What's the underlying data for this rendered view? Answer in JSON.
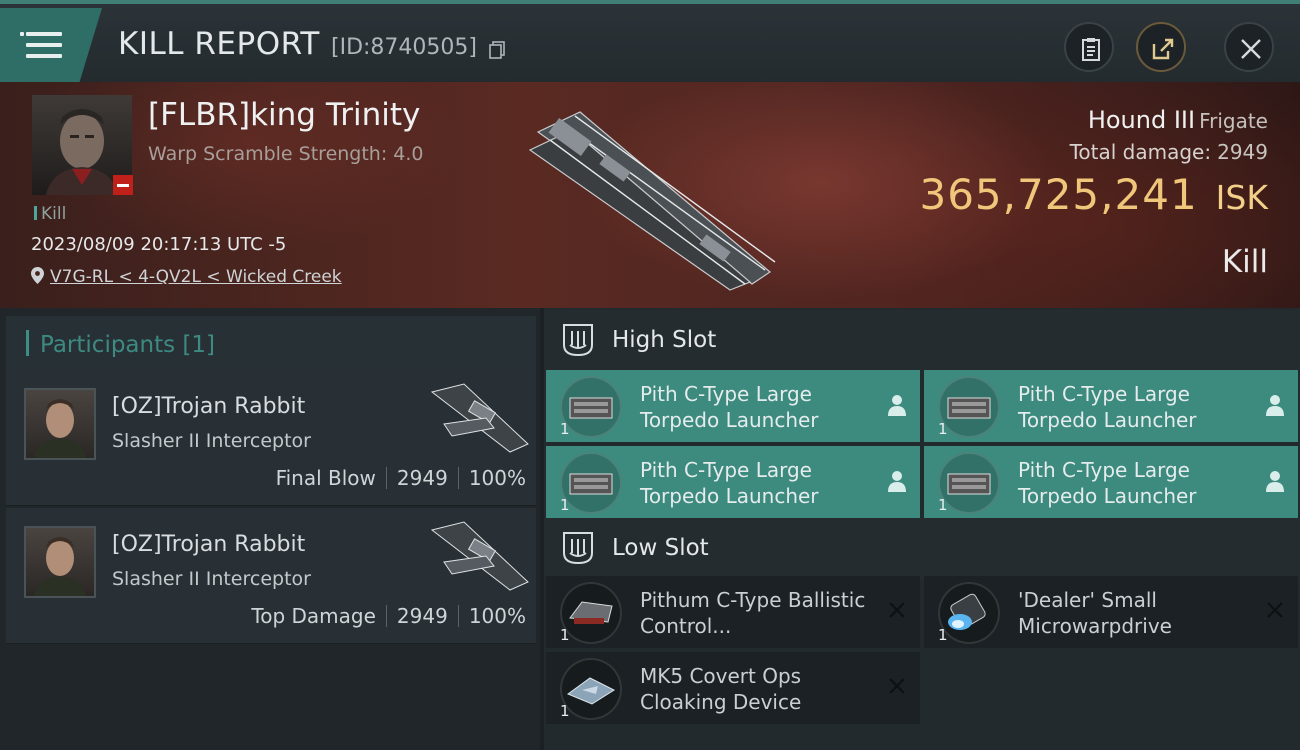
{
  "header": {
    "title": "KILL REPORT",
    "report_id": "[ID:8740505]"
  },
  "victim": {
    "name": "[FLBR]king Trinity",
    "warp_scramble": "Warp Scramble Strength: 4.0",
    "tag": "Kill",
    "datetime": "2023/08/09 20:17:13 UTC -5",
    "location": "V7G-RL < 4-QV2L < Wicked Creek",
    "ship": "Hound III",
    "ship_class": "Frigate",
    "total_damage_label": "Total damage:",
    "total_damage": "2949",
    "isk_value": "365,725,241",
    "isk_label": "ISK",
    "result": "Kill"
  },
  "participants": {
    "title": "Participants [1]",
    "rows": [
      {
        "name": "[OZ]Trojan Rabbit",
        "ship": "Slasher II Interceptor",
        "role": "Final Blow",
        "damage": "2949",
        "percent": "100%"
      },
      {
        "name": "[OZ]Trojan Rabbit",
        "ship": "Slasher II Interceptor",
        "role": "Top Damage",
        "damage": "2949",
        "percent": "100%"
      }
    ]
  },
  "fitting": {
    "high_slot": {
      "title": "High Slot",
      "items": [
        {
          "name": "Pith C-Type Large Torpedo Launcher",
          "qty": "1"
        },
        {
          "name": "Pith C-Type Large Torpedo Launcher",
          "qty": "1"
        },
        {
          "name": "Pith C-Type Large Torpedo Launcher",
          "qty": "1"
        },
        {
          "name": "Pith C-Type Large Torpedo Launcher",
          "qty": "1"
        }
      ]
    },
    "low_slot": {
      "title": "Low Slot",
      "items": [
        {
          "name": "Pithum C-Type Ballistic Control...",
          "qty": "1"
        },
        {
          "name": "'Dealer' Small Microwarpdrive",
          "qty": "1"
        },
        {
          "name": "MK5 Covert Ops Cloaking Device",
          "qty": "1"
        }
      ]
    }
  },
  "colors": {
    "accent": "#3d8a7f",
    "isk": "#f0c77a",
    "danger": "#c0201a"
  },
  "icons": [
    "menu-icon",
    "copy-icon",
    "clipboard-icon",
    "share-icon",
    "close-icon",
    "location-pin-icon",
    "slot-icon",
    "person-icon",
    "destroyed-x-icon"
  ]
}
